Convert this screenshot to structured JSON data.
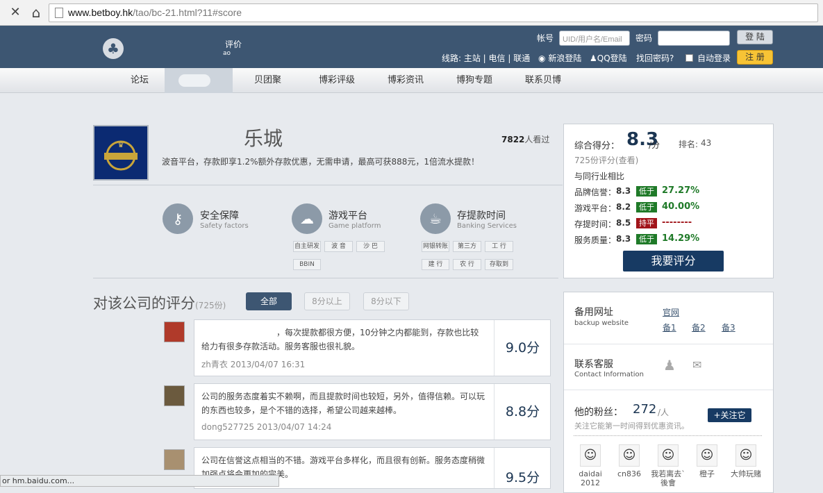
{
  "browser": {
    "url_domain": "www.betboy.hk",
    "url_path": "/tao/bc-21.html?11#score",
    "stop_icon": "✕",
    "home_icon": "⌂"
  },
  "header": {
    "logo_icon": "♣",
    "title": "评价",
    "sub": "ao",
    "account_label": "帐号",
    "account_placeholder": "UID/用户名/Email",
    "password_label": "密码",
    "login": "登 陆",
    "line_info": "线路: 主站 | 电信 | 联通",
    "weibo_login": "新浪登陆",
    "qq_login": "QQ登陆",
    "forgot": "找回密码?",
    "auto_login": "自动登录",
    "register": "注 册"
  },
  "nav": {
    "items": [
      "论坛",
      "贝团聚",
      "博彩评级",
      "博彩资讯",
      "博狗专题",
      "联系贝博"
    ]
  },
  "company": {
    "name": "乐城",
    "desc": "波音平台，存款即享1.2%额外存款优惠，无需申请，最高可获888元，1倍流水提款！",
    "views_num": "7822",
    "views_suffix": "人看过"
  },
  "features": [
    {
      "icon": "key-icon",
      "glyph": "⚷",
      "title": "安全保障",
      "sub": "Safety factors",
      "tags": []
    },
    {
      "icon": "cloud-icon",
      "glyph": "☁",
      "title": "游戏平台",
      "sub": "Game platform",
      "tags": [
        "自主研发",
        "波 音",
        "沙 巴",
        "BBIN"
      ]
    },
    {
      "icon": "coffee-icon",
      "glyph": "☕",
      "title": "存提款时间",
      "sub": "Banking Services",
      "tags": [
        "网银转账",
        "第三方",
        "工 行",
        "建 行",
        "农 行",
        "存取到"
      ]
    }
  ],
  "rating": {
    "overall_label": "综合得分：",
    "score": "8.3",
    "score_unit": "/分",
    "rank_label": "排名:",
    "rank": "43",
    "reviews": "725份评分(查看)",
    "compare": "与同行业相比",
    "rows": [
      {
        "label": "品牌信誉：",
        "score": "8.3",
        "badge": "低于",
        "pct": "27.27%",
        "kind": "low"
      },
      {
        "label": "游戏平台：",
        "score": "8.2",
        "badge": "低于",
        "pct": "40.00%",
        "kind": "low"
      },
      {
        "label": "存提时间：",
        "score": "8.5",
        "badge": "持平",
        "pct": "--------",
        "kind": "flat"
      },
      {
        "label": "服务质量：",
        "score": "8.3",
        "badge": "低于",
        "pct": "14.29%",
        "kind": "low"
      }
    ],
    "rate_button": "我要评分"
  },
  "reviews_header": {
    "title": "对该公司的评分",
    "count": "(725份)",
    "filters": [
      "全部",
      "8分以上",
      "8分以下"
    ]
  },
  "reviews": [
    {
      "text": "，每次提款都很方便，10分钟之内都能到，存款也比较给力有很多存款活动。服务客服也很礼貌。",
      "meta": "zh青衣 2013/04/07 16:31",
      "score": "9.0分"
    },
    {
      "text": "公司的服务态度着实不赖啊，而且提款时间也较短，另外，值得信赖。可以玩的东西也较多，是个不错的选择，希望公司越来越棒。",
      "meta": "dong527725 2013/04/07 14:24",
      "score": "8.8分"
    },
    {
      "text": "公司在信誉这点相当的不错。游戏平台多样化，而且很有创新。服务态度稍微加强点将会更加的完美。",
      "meta": "",
      "score": "9.5分"
    }
  ],
  "side": {
    "backup_title": "备用网址",
    "backup_sub": "backup website",
    "links": [
      "官网",
      "备1",
      "备2",
      "备3"
    ],
    "contact_title": "联系客服",
    "contact_sub": "Contact Information",
    "fans_label": "他的粉丝：",
    "fans_count": "272",
    "fans_unit": "/人",
    "fans_desc": "关注它能第一时间得到优惠资讯。",
    "follow": "+关注它",
    "fans": [
      "daidai 2012",
      "cn836",
      "我若离去`後會",
      "橙子",
      "大帅玩赌"
    ]
  },
  "status_text": "or hm.baidu.com..."
}
